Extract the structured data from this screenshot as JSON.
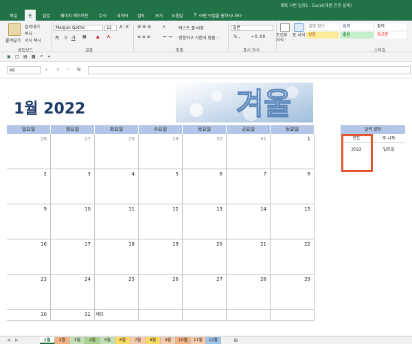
{
  "window": {
    "title": "계획 사번 일정1 - Excel(제품 인증 실패)"
  },
  "menu": {
    "tabs": [
      "파일",
      "홈",
      "삽입",
      "페이지 레이아웃",
      "수식",
      "데이터",
      "검토",
      "보기",
      "도움말"
    ],
    "tell_me": "어떤 작업을 원하시나요?"
  },
  "ribbon": {
    "paste": "붙여넣기",
    "cut": "잘라내기",
    "copy": "복사 ·",
    "format_painter": "서식 복사",
    "font_name": "Malgun Gothic",
    "font_size": "12",
    "wrap_text": "텍스트 줄 바꿈",
    "merge": "병합하고 가운데 맞춤 ·",
    "number_format": "일반",
    "percent": "% ,",
    "cond_format": "조건부 서식 ·",
    "table_format": "표 서식 ·",
    "styles": {
      "s1": "설명 정보",
      "s2": "입력",
      "s3": "출력",
      "s4": "보통",
      "s5": "좋음",
      "s6": "경고문"
    },
    "groups": {
      "clipboard": "클립보드",
      "font": "글꼴",
      "alignment": "맞춤",
      "number": "표시 형식",
      "style": "스타일"
    }
  },
  "formula_bar": {
    "name_box": "K6",
    "fx": "fx"
  },
  "calendar": {
    "month_title": "1월 2022",
    "winter_text": "겨울",
    "days": [
      "일요일",
      "월요일",
      "화요일",
      "수요일",
      "목요일",
      "금요일",
      "토요일"
    ],
    "weeks": [
      [
        "26",
        "27",
        "28",
        "29",
        "30",
        "31",
        "1"
      ],
      [
        "2",
        "3",
        "4",
        "5",
        "6",
        "7",
        "8"
      ],
      [
        "9",
        "10",
        "11",
        "12",
        "13",
        "14",
        "15"
      ],
      [
        "16",
        "17",
        "18",
        "19",
        "20",
        "21",
        "22"
      ],
      [
        "23",
        "24",
        "25",
        "26",
        "27",
        "28",
        "29"
      ],
      [
        "30",
        "31",
        "",
        "",
        "",
        "",
        ""
      ]
    ],
    "memo": "메모"
  },
  "side": {
    "title": "달력 설정",
    "year_label": "연도",
    "start_label": "주 시작",
    "year_value": "2022",
    "start_value": "일요일"
  },
  "sheets": [
    "1월",
    "2월",
    "3월",
    "4월",
    "5월",
    "6월",
    "7월",
    "8월",
    "9월",
    "10월",
    "11월",
    "12월"
  ],
  "colors": {
    "excel_green": "#217346",
    "header_blue": "#b4c6e7",
    "title_navy": "#1f3a68",
    "highlight": "#e4572e"
  }
}
